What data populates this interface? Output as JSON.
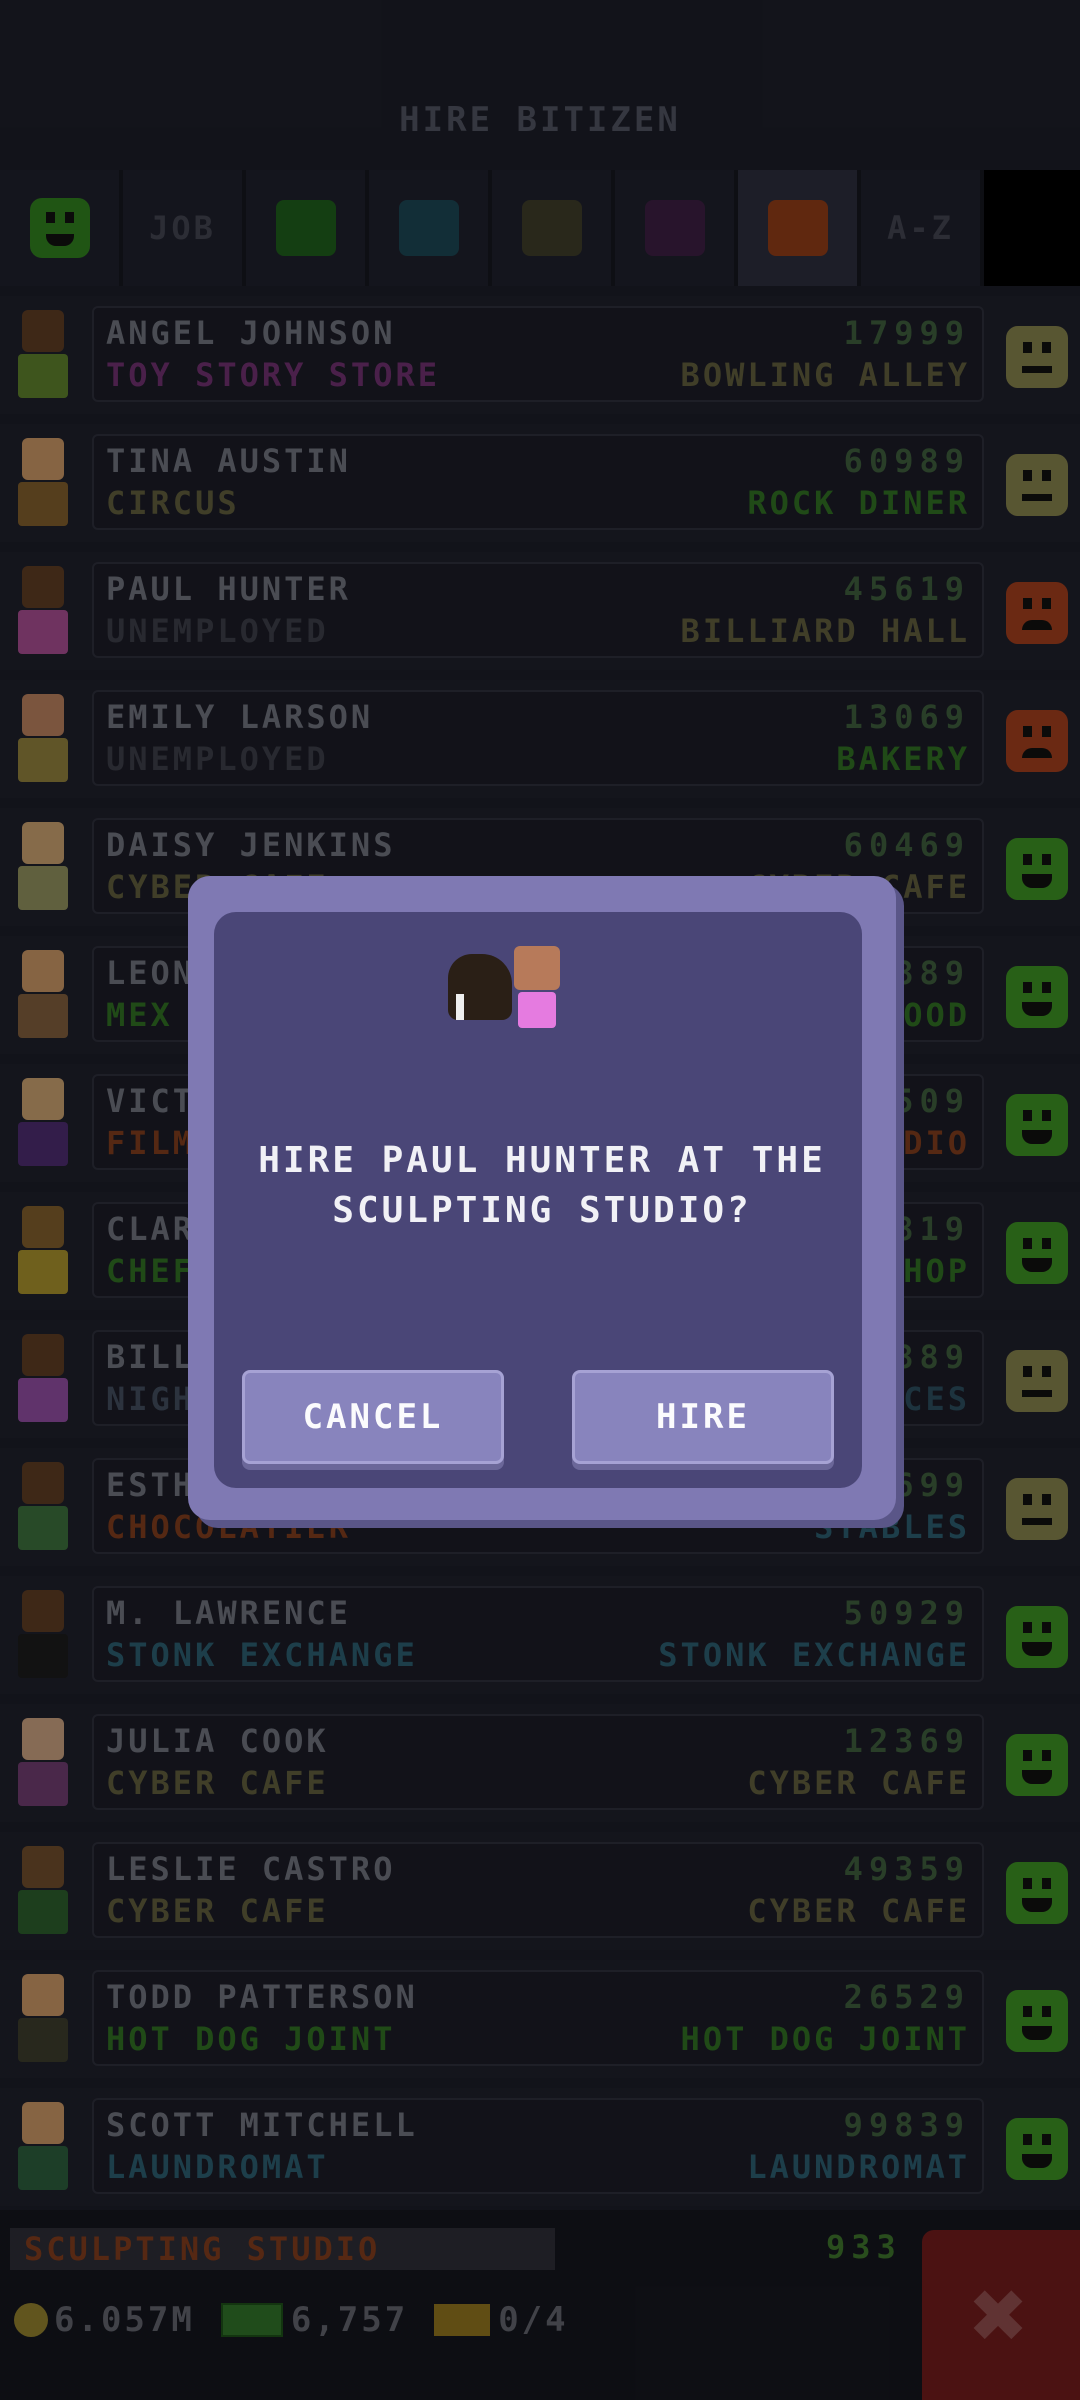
{
  "title": "HIRE BITIZEN",
  "filters": {
    "job_label": "JOB",
    "az_label": "A-Z",
    "smiley_color": "#2f7a1e",
    "colors": [
      "#1e5a1a",
      "#1a4350",
      "#3b3a28",
      "#3a1e3f",
      "#8a3a16"
    ]
  },
  "rows": [
    {
      "name": "ANGEL JOHNSON",
      "job": "TOY STORY STORE",
      "job_color": "#6b2f6a",
      "num": "17999",
      "dream": "BOWLING ALLEY",
      "dream_color": "#5c5a3a",
      "mood": "neutral",
      "skin": "#5a3a22",
      "shirt": "#5a7a2a"
    },
    {
      "name": "TINA AUSTIN",
      "job": "CIRCUS",
      "job_color": "#5c5a3a",
      "num": "60989",
      "dream": "ROCK DINER",
      "dream_color": "#2f6a22",
      "mood": "neutral",
      "skin": "#c09060",
      "shirt": "#7a5a2a"
    },
    {
      "name": "PAUL HUNTER",
      "job": "UNEMPLOYED",
      "job_color": "#3a3b45",
      "num": "45619",
      "dream": "BILLIARD HALL",
      "dream_color": "#5c5a3a",
      "mood": "sad",
      "skin": "#5a3a22",
      "shirt": "#a04a8a"
    },
    {
      "name": "EMILY LARSON",
      "job": "UNEMPLOYED",
      "job_color": "#3a3b45",
      "num": "13069",
      "dream": "BAKERY",
      "dream_color": "#2f6a22",
      "mood": "sad",
      "skin": "#b07a5a",
      "shirt": "#8a7a3a"
    },
    {
      "name": "DAISY JENKINS",
      "job": "CYBER CAFE",
      "job_color": "#5c5a3a",
      "num": "60469",
      "dream": "CYBER CAFE",
      "dream_color": "#5c5a3a",
      "mood": "happy",
      "skin": "#c09a6a",
      "shirt": "#8a8a5a"
    },
    {
      "name": "LEON",
      "job": "MEX",
      "job_color": "#2f6a22",
      "num": "889",
      "dream": "FOOD",
      "dream_color": "#2f6a22",
      "mood": "happy",
      "skin": "#c09060",
      "shirt": "#7a5a3a"
    },
    {
      "name": "VICT",
      "job": "FILM",
      "job_color": "#7a3a1c",
      "num": "509",
      "dream": "STUDIO",
      "dream_color": "#7a3a1c",
      "mood": "happy",
      "skin": "#c09a6a",
      "shirt": "#4a2a6a"
    },
    {
      "name": "CLAR",
      "job": "CHEF",
      "job_color": "#2f6a22",
      "num": "819",
      "dream": "SHOP",
      "dream_color": "#2f6a22",
      "mood": "happy",
      "skin": "#7a5a2a",
      "shirt": "#a08a2a"
    },
    {
      "name": "BILL",
      "job": "NIGH",
      "job_color": "#3f4a5a",
      "num": "889",
      "dream": "PLACES",
      "dream_color": "#2a4a5a",
      "mood": "neutral",
      "skin": "#5a3a22",
      "shirt": "#8a4a9a"
    },
    {
      "name": "ESTH",
      "job": "CHOCOLATIER",
      "job_color": "#7a3a1c",
      "num": "699",
      "dream": "STABLES",
      "dream_color": "#2a5a6a",
      "mood": "neutral",
      "skin": "#5a3a22",
      "shirt": "#3a6a3a"
    },
    {
      "name": "M. LAWRENCE",
      "job": "STONK EXCHANGE",
      "job_color": "#2a5a6a",
      "num": "50929",
      "dream": "STONK EXCHANGE",
      "dream_color": "#2a5a6a",
      "mood": "happy",
      "skin": "#5a3a22",
      "shirt": "#1a1a1a"
    },
    {
      "name": "JULIA COOK",
      "job": "CYBER CAFE",
      "job_color": "#5c5a3a",
      "num": "12369",
      "dream": "CYBER CAFE",
      "dream_color": "#5c5a3a",
      "mood": "happy",
      "skin": "#c09a7a",
      "shirt": "#6a3a6a"
    },
    {
      "name": "LESLIE CASTRO",
      "job": "CYBER CAFE",
      "job_color": "#5c5a3a",
      "num": "49359",
      "dream": "CYBER CAFE",
      "dream_color": "#5c5a3a",
      "mood": "happy",
      "skin": "#6a4a2a",
      "shirt": "#2a5a2a"
    },
    {
      "name": "TODD PATTERSON",
      "job": "HOT DOG JOINT",
      "job_color": "#2f6a22",
      "num": "26529",
      "dream": "HOT DOG JOINT",
      "dream_color": "#2f6a22",
      "mood": "happy",
      "skin": "#c09060",
      "shirt": "#3a3a2a"
    },
    {
      "name": "SCOTT MITCHELL",
      "job": "LAUNDROMAT",
      "job_color": "#2a5a6a",
      "num": "99839",
      "dream": "LAUNDROMAT",
      "dream_color": "#2a5a6a",
      "mood": "happy",
      "skin": "#c09060",
      "shirt": "#2a5a3a"
    }
  ],
  "bottom": {
    "studio": "SCULPTING STUDIO",
    "partial_num": "933",
    "coins": "6.057M",
    "bux": "6,757",
    "tickets": "0/4",
    "close_glyph": "✖"
  },
  "dialog": {
    "line1": "HIRE PAUL HUNTER AT THE",
    "line2": "SCULPTING STUDIO?",
    "cancel": "CANCEL",
    "hire": "HIRE"
  }
}
